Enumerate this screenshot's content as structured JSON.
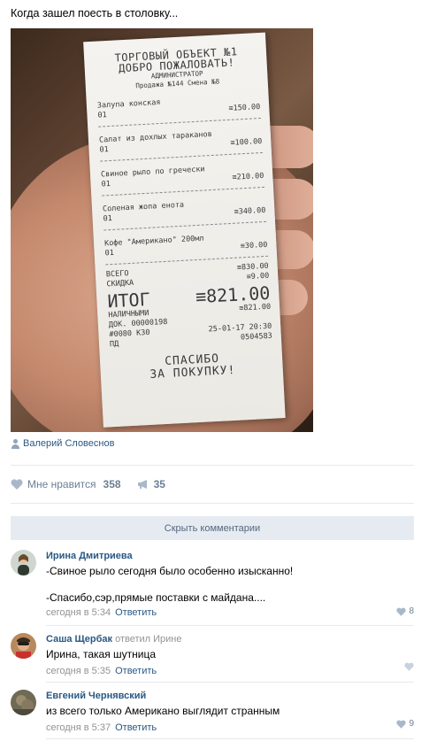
{
  "post": {
    "text": "Когда зашел поесть в столовку...",
    "author": "Валерий Словеснов"
  },
  "receipt": {
    "header_line1": "ТОРГОВЫЙ ОБЪЕКТ №1",
    "header_line2": "ДОБРО ПОЖАЛОВАТЬ!",
    "role": "АДМИНИСТРАТОР",
    "sale_info": "Продажа №144 Смена №8",
    "items": [
      {
        "name": "Залупа конская",
        "qty": "01",
        "price": "≡150.00"
      },
      {
        "name": "Салат из дохлых тараканов",
        "qty": "01",
        "price": "≡100.00"
      },
      {
        "name": "Свиное рыло по гречески",
        "qty": "01",
        "price": "≡210.00"
      },
      {
        "name": "Соленая жопа енота",
        "qty": "01",
        "price": "≡340.00"
      },
      {
        "name": "Кофе \"Американо\" 200мл",
        "qty": "01",
        "price": "≡30.00"
      }
    ],
    "subtotal_label": "ВСЕГО",
    "subtotal": "≡830.00",
    "discount_label": "СКИДКА",
    "discount": "≡9.00",
    "total_label": "ИТОГ",
    "total": "≡821.00",
    "cash_label": "НАЛИЧНЫМИ",
    "cash": "≡821.00",
    "doc": "ДОК. 00000198",
    "terminal": "#0080 КЗ0",
    "datetime": "25-01-17 20:30",
    "pd_label": "ПД",
    "pd": "0504583",
    "thanks_line1": "СПАСИБО",
    "thanks_line2": "ЗА ПОКУПКУ!"
  },
  "actions": {
    "like_label": "Мне нравится",
    "like_count": "358",
    "share_count": "35"
  },
  "hide_comments_label": "Скрыть комментарии",
  "comments": [
    {
      "author": "Ирина Дмитриева",
      "reply_to": "",
      "text1": "-Свиное рыло сегодня было особенно изысканно!",
      "text2": "-Спасибо,сэр,прямые поставки с майдана....",
      "time": "сегодня в 5:34",
      "reply_label": "Ответить",
      "likes": "8"
    },
    {
      "author": "Саша Щербак",
      "reply_to": "ответил Ирине",
      "text1": "Ирина, такая шутница",
      "time": "сегодня в 5:35",
      "reply_label": "Ответить",
      "likes": ""
    },
    {
      "author": "Евгений Чернявский",
      "reply_to": "",
      "text1": "из всего только Американо выглядит странным",
      "time": "сегодня в 5:37",
      "reply_label": "Ответить",
      "likes": "9"
    }
  ],
  "colors": {
    "link": "#2a5885",
    "muted": "#939393",
    "icon": "#6b7e94",
    "button_bg": "#e5ebf1"
  }
}
